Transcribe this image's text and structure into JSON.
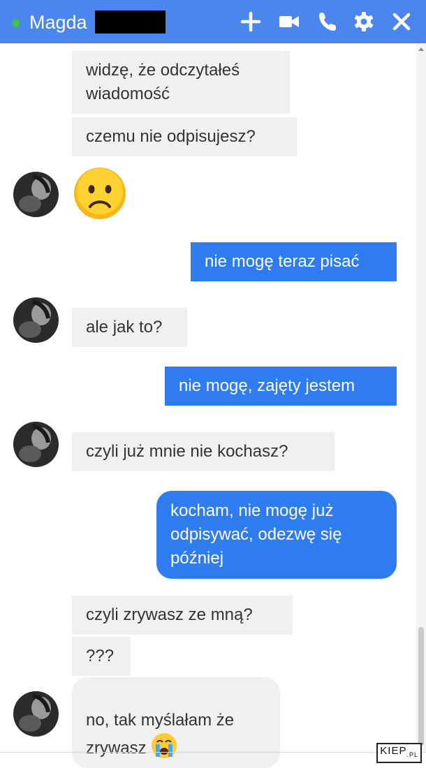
{
  "header": {
    "contact_name": "Magda",
    "status": "online",
    "icons": [
      "plus-icon",
      "video-call-icon",
      "phone-icon",
      "gear-icon",
      "close-icon"
    ]
  },
  "messages": [
    {
      "sender": "contact",
      "text": "widzę, że odczytałeś\nwiadomość"
    },
    {
      "sender": "contact",
      "text": "czemu nie odpisujesz?"
    },
    {
      "sender": "contact",
      "emoji": "sad-face-emoji"
    },
    {
      "sender": "me",
      "text": "nie mogę teraz pisać"
    },
    {
      "sender": "contact",
      "text": "ale jak to?"
    },
    {
      "sender": "me",
      "text": "nie mogę, zajęty jestem"
    },
    {
      "sender": "contact",
      "text": "czyli już mnie nie kochasz?"
    },
    {
      "sender": "me",
      "text": "kocham, nie mogę już\nodpisywać, odezwę się\npóźniej"
    },
    {
      "sender": "contact",
      "text": "czyli zrywasz ze mną?"
    },
    {
      "sender": "contact",
      "text": "???"
    },
    {
      "sender": "contact",
      "text": "no, tak myślałam że\nzrywasz",
      "emoji": "crying-face-emoji"
    }
  ],
  "watermark": {
    "brand": "KIEP",
    "suffix": ".PL"
  },
  "colors": {
    "header": "#4a86ee",
    "outgoing": "#2f7cf0",
    "incoming": "#f0f0f0",
    "online": "#3ec73e"
  }
}
